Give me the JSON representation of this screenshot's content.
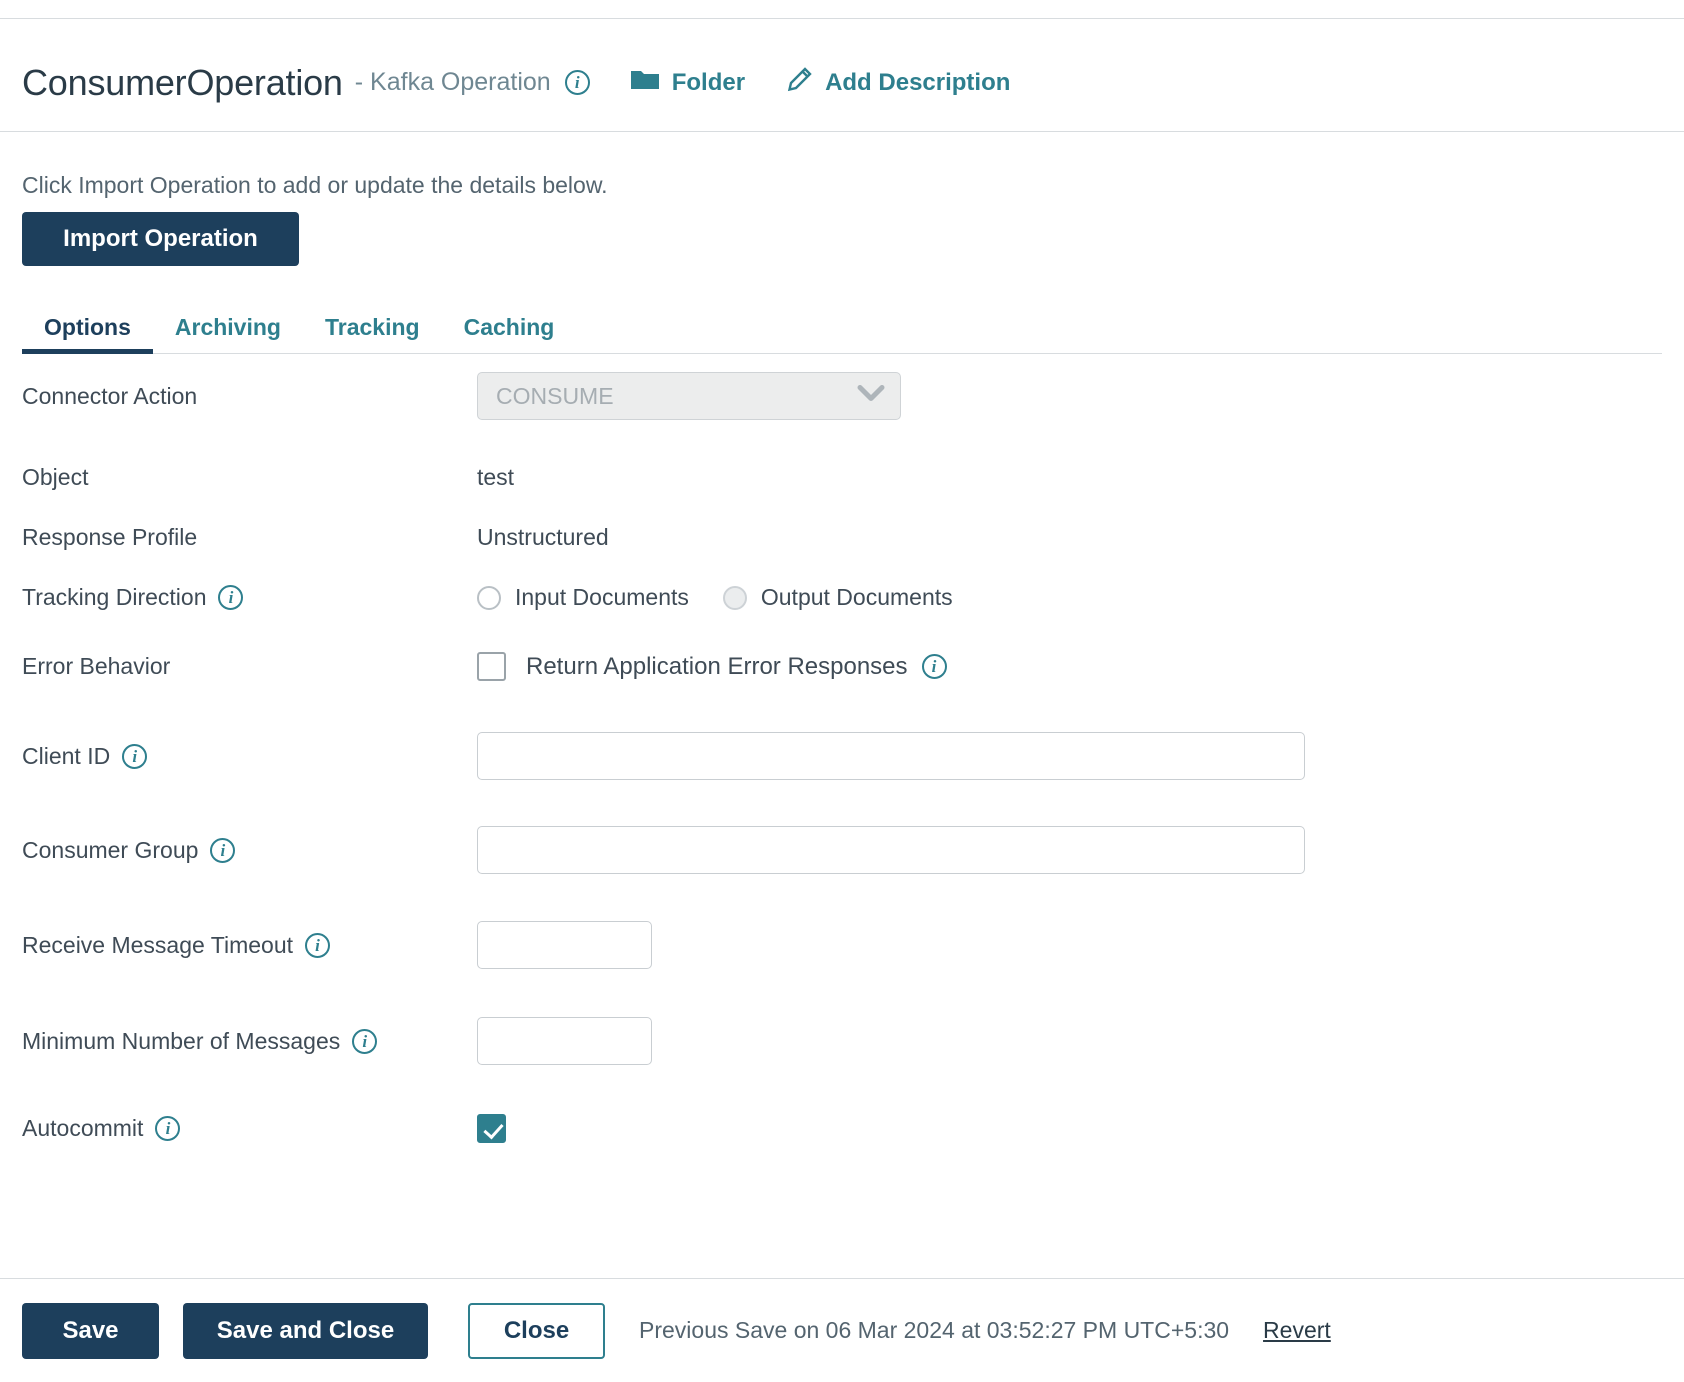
{
  "header": {
    "title": "ConsumerOperation",
    "separator": "-",
    "subtitle": "Kafka Operation",
    "info_icon": "info-icon",
    "folder_icon": "folder-icon",
    "folder_label": "Folder",
    "pencil_icon": "pencil-icon",
    "add_description_label": "Add Description"
  },
  "instruction": "Click Import Operation to add or update the details below.",
  "import_button": "Import Operation",
  "tabs": [
    {
      "label": "Options",
      "active": true
    },
    {
      "label": "Archiving",
      "active": false
    },
    {
      "label": "Tracking",
      "active": false
    },
    {
      "label": "Caching",
      "active": false
    }
  ],
  "fields": {
    "connector_action": {
      "label": "Connector Action",
      "value": "CONSUME",
      "disabled": true,
      "chevron_icon": "chevron-down-icon"
    },
    "object": {
      "label": "Object",
      "value": "test"
    },
    "response_profile": {
      "label": "Response Profile",
      "value": "Unstructured"
    },
    "tracking_direction": {
      "label": "Tracking Direction",
      "options": [
        {
          "label": "Input Documents",
          "selected": false,
          "disabled": false
        },
        {
          "label": "Output Documents",
          "selected": false,
          "disabled": true
        }
      ]
    },
    "error_behavior": {
      "label": "Error Behavior",
      "checkbox_label": "Return Application Error Responses",
      "checked": false
    },
    "client_id": {
      "label": "Client ID",
      "value": "",
      "placeholder": ""
    },
    "consumer_group": {
      "label": "Consumer Group",
      "value": "",
      "placeholder": ""
    },
    "receive_message_timeout": {
      "label": "Receive Message Timeout",
      "value": "",
      "placeholder": ""
    },
    "minimum_number_of_messages": {
      "label": "Minimum Number of Messages",
      "value": "",
      "placeholder": ""
    },
    "autocommit": {
      "label": "Autocommit",
      "checked": true
    }
  },
  "footer": {
    "save": "Save",
    "save_and_close": "Save and Close",
    "close": "Close",
    "previous_save": "Previous Save on 06 Mar 2024 at 03:52:27 PM UTC+5:30",
    "revert": "Revert"
  },
  "colors": {
    "navy": "#1d3f5c",
    "teal": "#2e7f8e",
    "text": "#3f4b56",
    "muted": "#6f8792",
    "border": "#d8dcdf"
  }
}
